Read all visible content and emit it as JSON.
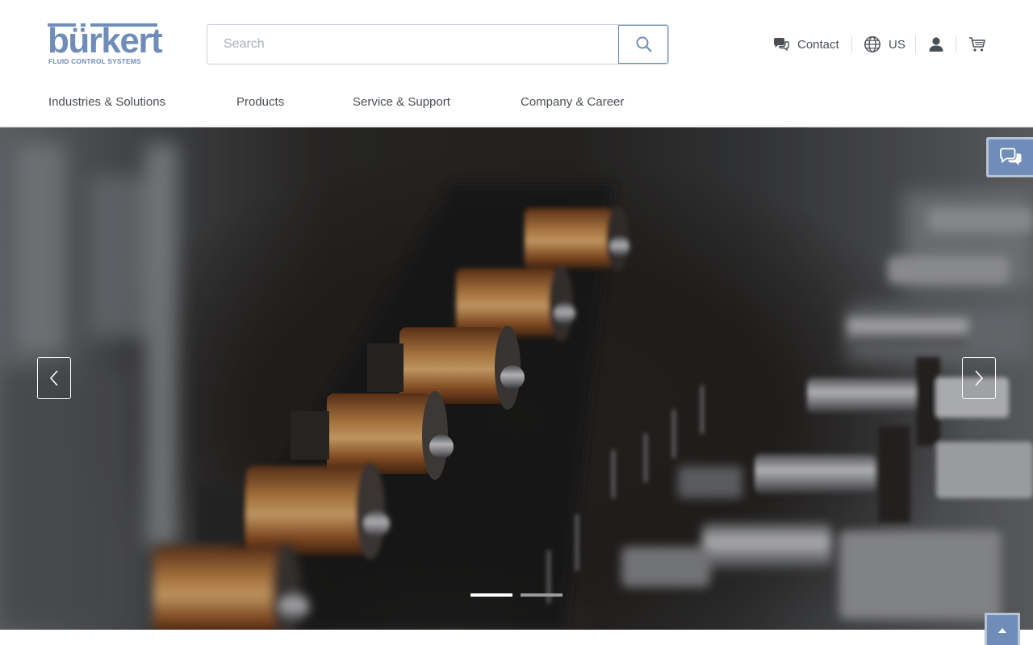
{
  "brand": {
    "name": "bürkert",
    "tagline": "FLUID CONTROL SYSTEMS",
    "color": "#6f8db8"
  },
  "search": {
    "placeholder": "Search",
    "value": "",
    "button_icon": "search-icon"
  },
  "utility": {
    "contact_label": "Contact",
    "contact_icon": "chat-bubbles-icon",
    "region_label": "US",
    "region_icon": "globe-icon",
    "account_icon": "user-icon",
    "cart_icon": "cart-icon"
  },
  "nav": {
    "items": [
      {
        "label": "Industries & Solutions"
      },
      {
        "label": "Products"
      },
      {
        "label": "Service & Support"
      },
      {
        "label": "Company & Career"
      }
    ]
  },
  "hero": {
    "image_icon": "hero-image",
    "prev_icon": "chevron-left-icon",
    "next_icon": "chevron-right-icon",
    "slides_total": 2,
    "active_slide": 1,
    "dot_active_color": "#ffffff",
    "dot_inactive_color": "#9a9a9a"
  },
  "floating": {
    "chat_icon": "chat-bubbles-icon",
    "to_top_icon": "arrow-up-icon"
  },
  "colors": {
    "accent": "#6f8db8",
    "text": "#4a4f55",
    "border": "#c6d0dd"
  }
}
